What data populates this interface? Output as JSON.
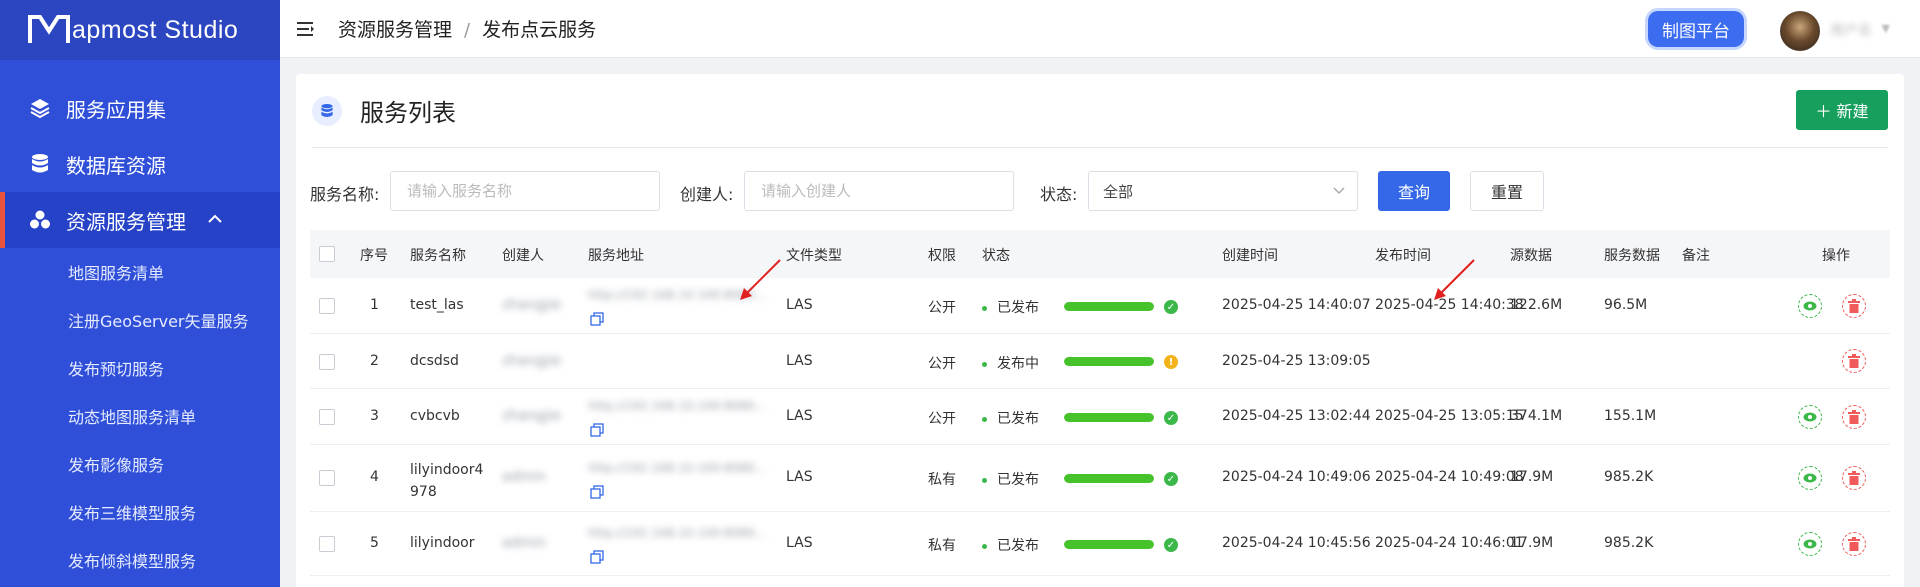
{
  "app": {
    "logo_text": "apmost Studio"
  },
  "sidebar": {
    "items": [
      {
        "label": "服务应用集",
        "icon": "layers-icon"
      },
      {
        "label": "数据库资源",
        "icon": "database-icon"
      },
      {
        "label": "资源服务管理",
        "icon": "cubes-icon",
        "active": true
      }
    ],
    "subitems": [
      "地图服务清单",
      "注册GeoServer矢量服务",
      "发布预切服务",
      "动态地图服务清单",
      "发布影像服务",
      "发布三维模型服务",
      "发布倾斜模型服务"
    ]
  },
  "header": {
    "breadcrumb": [
      "资源服务管理",
      "发布点云服务"
    ],
    "separator": "/",
    "platform_button": "制图平台",
    "username": "用户名"
  },
  "card": {
    "title": "服务列表",
    "new_button": "＋ 新建"
  },
  "filters": {
    "name_label": "服务名称:",
    "name_placeholder": "请输入服务名称",
    "creator_label": "创建人:",
    "creator_placeholder": "请输入创建人",
    "status_label": "状态:",
    "status_value": "全部",
    "query_button": "查询",
    "reset_button": "重置"
  },
  "table": {
    "headers": {
      "index": "序号",
      "name": "服务名称",
      "creator": "创建人",
      "address": "服务地址",
      "filetype": "文件类型",
      "permission": "权限",
      "status": "状态",
      "created": "创建时间",
      "published": "发布时间",
      "source_size": "源数据",
      "service_size": "服务数据",
      "note": "备注",
      "actions": "操作"
    },
    "rows": [
      {
        "index": "1",
        "name": "test_las",
        "creator": "zhangjie",
        "address": "http://192.168.10.100:8080...",
        "filetype": "LAS",
        "permission": "公开",
        "status": "已发布",
        "progress": 1.0,
        "state": "ok",
        "created": "2025-04-25 14:40:07",
        "published": "2025-04-25 14:40:38",
        "source_size": "122.6M",
        "service_size": "96.5M",
        "has_copy": true,
        "has_view": true
      },
      {
        "index": "2",
        "name": "dcsdsd",
        "creator": "zhangjie",
        "address": "",
        "filetype": "LAS",
        "permission": "公开",
        "status": "发布中",
        "progress": 1.0,
        "state": "warn",
        "created": "2025-04-25 13:09:05",
        "published": "",
        "source_size": "",
        "service_size": "",
        "has_copy": false,
        "has_view": false
      },
      {
        "index": "3",
        "name": "cvbcvb",
        "creator": "zhangjie",
        "address": "http://192.168.10.100:8080...",
        "filetype": "LAS",
        "permission": "公开",
        "status": "已发布",
        "progress": 1.0,
        "state": "ok",
        "created": "2025-04-25 13:02:44",
        "published": "2025-04-25 13:05:15",
        "source_size": "374.1M",
        "service_size": "155.1M",
        "has_copy": true,
        "has_view": true
      },
      {
        "index": "4",
        "name": "lilyindoor4978",
        "creator": "admin",
        "address": "http://192.168.10.100:8080...",
        "filetype": "LAS",
        "permission": "私有",
        "status": "已发布",
        "progress": 1.0,
        "state": "ok",
        "created": "2025-04-24 10:49:06",
        "published": "2025-04-24 10:49:08",
        "source_size": "17.9M",
        "service_size": "985.2K",
        "has_copy": true,
        "has_view": true
      },
      {
        "index": "5",
        "name": "lilyindoor",
        "creator": "admin",
        "address": "http://192.168.10.100:8080...",
        "filetype": "LAS",
        "permission": "私有",
        "status": "已发布",
        "progress": 1.0,
        "state": "ok",
        "created": "2025-04-24 10:45:56",
        "published": "2025-04-24 10:46:01",
        "source_size": "17.9M",
        "service_size": "985.2K",
        "has_copy": true,
        "has_view": true
      }
    ]
  },
  "colors": {
    "sidebar": "#2f4fd8",
    "primary": "#3468e8",
    "success": "#17a05d",
    "progress": "#46c22a",
    "warn": "#f4b21a",
    "danger": "#f05a5a"
  }
}
